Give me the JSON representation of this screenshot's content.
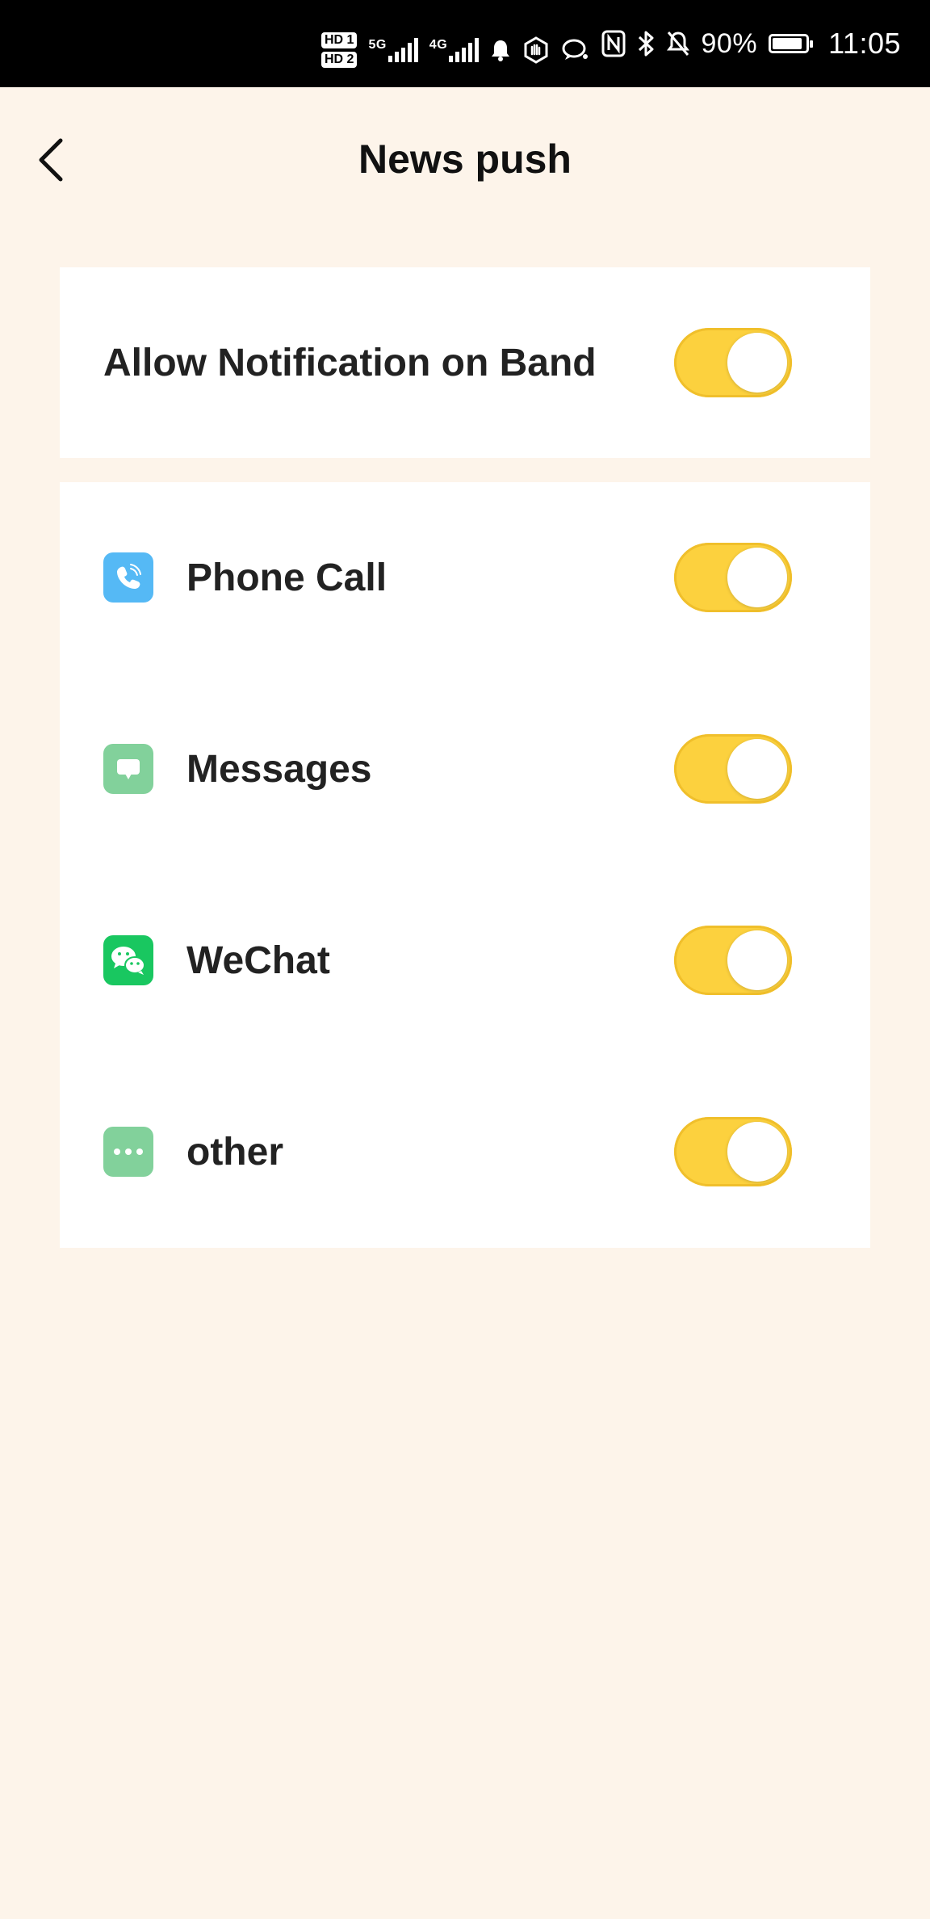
{
  "status_bar": {
    "hd1": "HD 1",
    "hd2": "HD 2",
    "net1": "5G",
    "net2": "4G",
    "battery_text": "90%",
    "battery_level": 0.9,
    "time": "11:05",
    "icons": [
      "hd-icon",
      "signal-5g-icon",
      "signal-4g-icon",
      "notification-bell-icon",
      "hand-icon",
      "chat-icon",
      "nfc-icon",
      "bluetooth-icon",
      "mute-icon",
      "battery-icon"
    ]
  },
  "header": {
    "title": "News push",
    "back_icon": "chevron-left-icon"
  },
  "main_toggle": {
    "label": "Allow Notification on Band",
    "enabled": true
  },
  "apps": [
    {
      "label": "Phone Call",
      "icon": "phone-icon",
      "color": "#55b9f5",
      "enabled": true
    },
    {
      "label": "Messages",
      "icon": "message-icon",
      "color": "#82d19b",
      "enabled": true
    },
    {
      "label": "WeChat",
      "icon": "wechat-icon",
      "color": "#19c760",
      "enabled": true
    },
    {
      "label": "other",
      "icon": "more-dots-icon",
      "color": "#82d19b",
      "enabled": true
    }
  ],
  "colors": {
    "background": "#fdf4ea",
    "card": "#ffffff",
    "toggle_on": "#fcd13e",
    "text": "#222222"
  }
}
